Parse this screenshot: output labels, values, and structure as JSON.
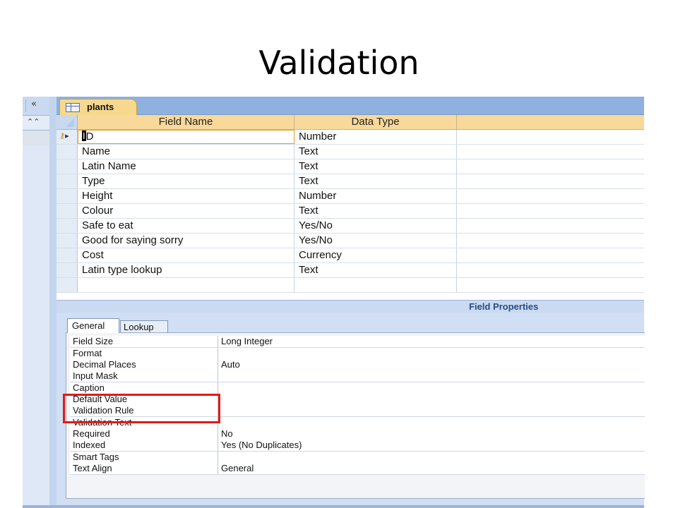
{
  "slide_title": "Validation",
  "nav": {
    "collapse_icon": "«",
    "section_icon": "⌃⌃"
  },
  "tab": {
    "label": "plants"
  },
  "grid": {
    "headers": {
      "field_name": "Field Name",
      "data_type": "Data Type"
    },
    "rows": [
      {
        "field": "D",
        "type": "Number"
      },
      {
        "field": "Name",
        "type": "Text"
      },
      {
        "field": "Latin Name",
        "type": "Text"
      },
      {
        "field": "Type",
        "type": "Text"
      },
      {
        "field": "Height",
        "type": "Number"
      },
      {
        "field": "Colour",
        "type": "Text"
      },
      {
        "field": "Safe to eat",
        "type": "Yes/No"
      },
      {
        "field": "Good for saying sorry",
        "type": "Yes/No"
      },
      {
        "field": "Cost",
        "type": "Currency"
      },
      {
        "field": "Latin type lookup",
        "type": "Text"
      },
      {
        "field": "",
        "type": ""
      }
    ]
  },
  "field_properties": {
    "label": "Field Properties",
    "tabs": {
      "general": "General",
      "lookup": "Lookup"
    },
    "rows": [
      {
        "name": "Field Size",
        "value": "Long Integer"
      },
      {
        "name": "Format",
        "value": ""
      },
      {
        "name": "Decimal Places",
        "value": "Auto"
      },
      {
        "name": "Input Mask",
        "value": ""
      },
      {
        "name": "Caption",
        "value": ""
      },
      {
        "name": "Default Value",
        "value": ""
      },
      {
        "name": "Validation Rule",
        "value": ""
      },
      {
        "name": "Validation Text",
        "value": ""
      },
      {
        "name": "Required",
        "value": "No"
      },
      {
        "name": "Indexed",
        "value": "Yes (No Duplicates)"
      },
      {
        "name": "Smart Tags",
        "value": ""
      },
      {
        "name": "Text Align",
        "value": "General"
      }
    ]
  },
  "colors": {
    "highlight_box": "#e01a1a",
    "tab_active": "#f6d98d",
    "header_bg": "#f8d99a",
    "accent_blue": "#8eb1e0"
  }
}
